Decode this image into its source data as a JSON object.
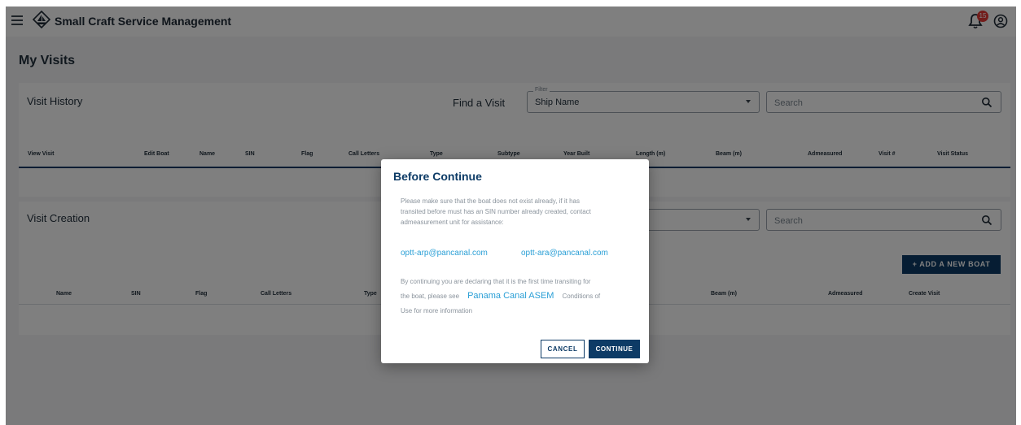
{
  "app": {
    "title": "Small Craft Service Management",
    "notification_count": "15",
    "brand_color": "#0d3b66",
    "badge_color": "#e53935",
    "icons": [
      "menu-icon",
      "ship-logo-icon",
      "notification-bell-icon",
      "account-icon",
      "search-icon",
      "chevron-down-icon",
      "plus-icon"
    ]
  },
  "page": {
    "title": "My Visits"
  },
  "visit_history": {
    "title": "Visit History",
    "find_label": "Find a Visit",
    "filter_legend": "Filter",
    "filter_value": "Ship Name",
    "search_placeholder": "Search",
    "columns": [
      "View Visit",
      "Edit Boat",
      "Name",
      "SIN",
      "Flag",
      "Call Letters",
      "Type",
      "Subtype",
      "Year Built",
      "Length (m)",
      "Beam (m)",
      "Admeasured",
      "Visit #",
      "Visit Status"
    ]
  },
  "visit_creation": {
    "title": "Visit Creation",
    "search_placeholder": "Search",
    "add_button": "ADD A NEW BOAT",
    "columns": [
      "Name",
      "SIN",
      "Flag",
      "Call Letters",
      "Type",
      "Beam (m)",
      "Admeasured",
      "Create Visit"
    ]
  },
  "dialog": {
    "title": "Before Continue",
    "text1_line1": "Please make sure that the boat does not exist already, if it has",
    "text1_line2": "transited before must has an SIN number already created, contact",
    "text1_line3": "admeasurement unit for assistance:",
    "email1": "optt-arp@pancanal.com",
    "email2": "optt-ara@pancanal.com",
    "text2_line1": "By continuing you are declaring that it is the first time transiting for",
    "text2_line2_start": "the boat, please see",
    "link_label": "Panama Canal ASEM",
    "text2_line2_end": "Conditions of",
    "text2_line3": "Use for more information",
    "cancel_label": "CANCEL",
    "continue_label": "CONTINUE"
  }
}
